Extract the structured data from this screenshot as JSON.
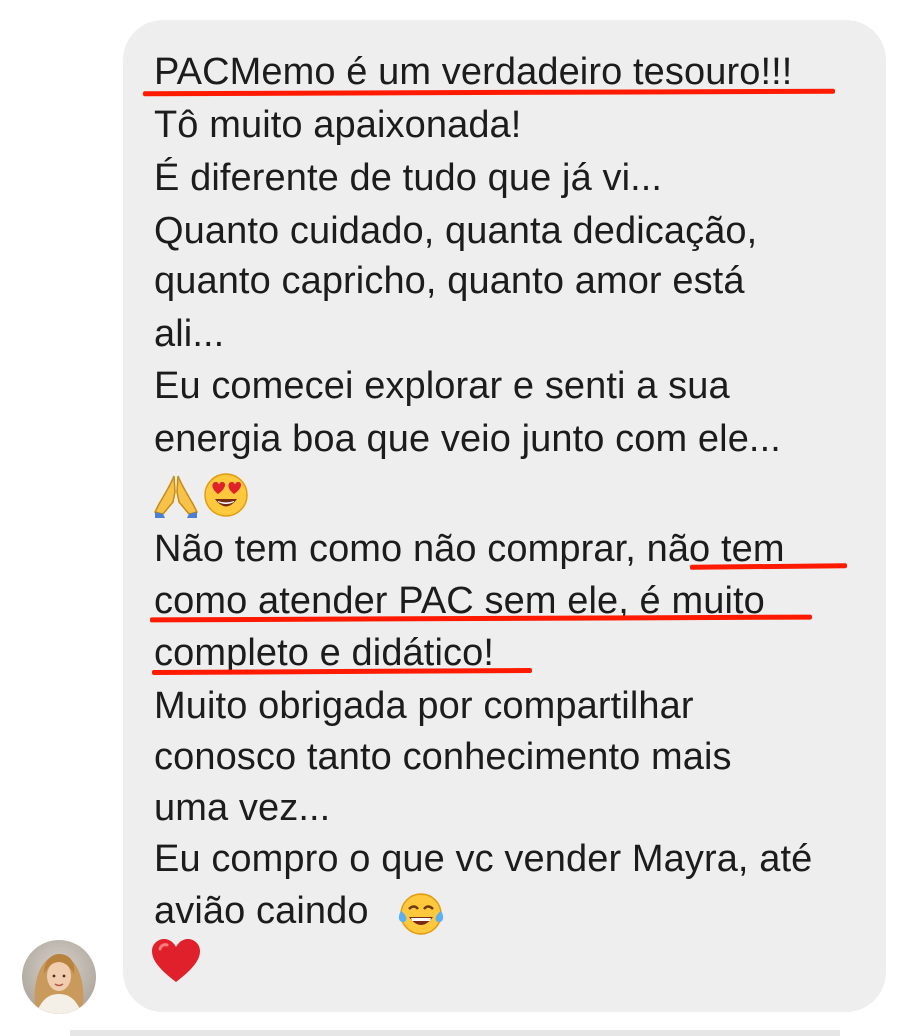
{
  "message": {
    "lines": [
      "PACMemo é um verdadeiro tesouro!!!",
      "Tô muito apaixonada!",
      "É diferente de tudo que já vi...",
      "Quanto cuidado, quanta dedicação,",
      "quanto capricho, quanto amor está",
      "ali...",
      "Eu comecei explorar e senti a sua",
      "energia boa que veio junto com ele...",
      "Não tem como não comprar, não tem",
      "como atender PAC sem ele, é muito",
      "completo e didático!",
      "Muito obrigada por compartilhar",
      "conosco tanto conhecimento mais",
      "uma vez...",
      "Eu compro o que vc vender Mayra, até",
      "avião caindo"
    ],
    "emojis": [
      "praying-hands",
      "heart-eyes",
      "tears-of-joy",
      "red-heart"
    ]
  },
  "colors": {
    "bubble": "#eeeeee",
    "text": "#1c1c1c",
    "underline": "#ff1a00",
    "heart": "#e0202a",
    "emoji_face": "#ffc83d"
  }
}
